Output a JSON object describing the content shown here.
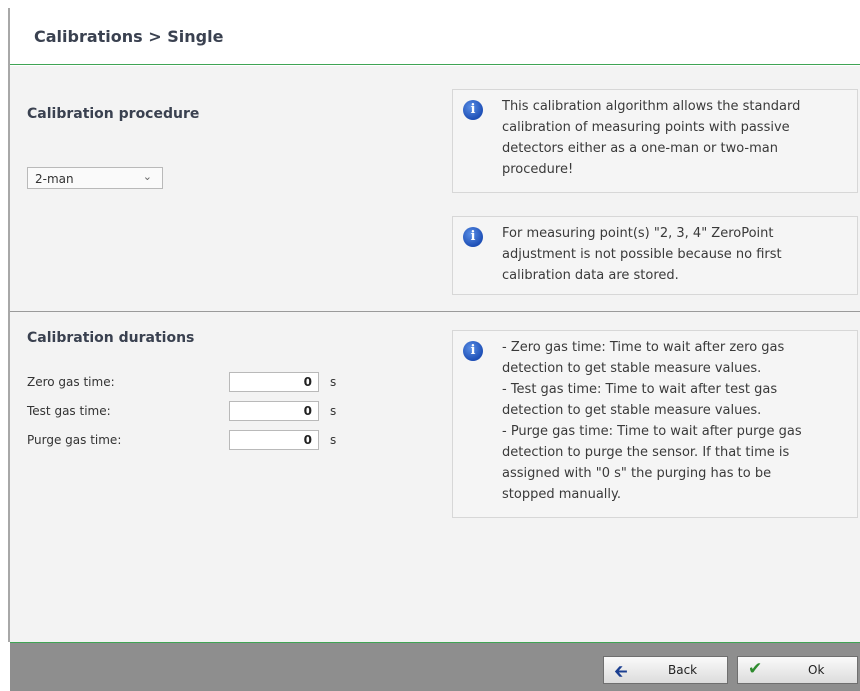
{
  "header": {
    "title": "Calibrations > Single"
  },
  "procedure": {
    "title": "Calibration procedure",
    "selected": "2-man",
    "info": [
      "This calibration algorithm allows the standard",
      "calibration of measuring points with passive",
      "detectors either as a one-man or two-man",
      "procedure!"
    ],
    "warning": [
      "For measuring point(s) \"2, 3, 4\" ZeroPoint",
      "adjustment is not possible because no first",
      "calibration data are stored."
    ]
  },
  "durations": {
    "title": "Calibration durations",
    "fields": [
      {
        "label": "Zero gas time:",
        "value": "0",
        "unit": "s"
      },
      {
        "label": "Test gas time:",
        "value": "0",
        "unit": "s"
      },
      {
        "label": "Purge gas time:",
        "value": "0",
        "unit": "s"
      }
    ],
    "info": [
      "- Zero gas time: Time to wait after zero gas",
      "detection to get stable measure values.",
      "- Test gas time: Time to wait after test gas",
      "detection to get stable measure values.",
      "- Purge gas time: Time to wait after purge gas",
      "detection to purge the sensor. If that time is",
      "assigned with \"0 s\" the purging has to be",
      "stopped manually."
    ]
  },
  "footer": {
    "back_label": "Back",
    "ok_label": "Ok"
  },
  "colors": {
    "accent_green": "#3fa454",
    "info_blue": "#1e4fb6",
    "footer_gray": "#8e8e8e"
  }
}
